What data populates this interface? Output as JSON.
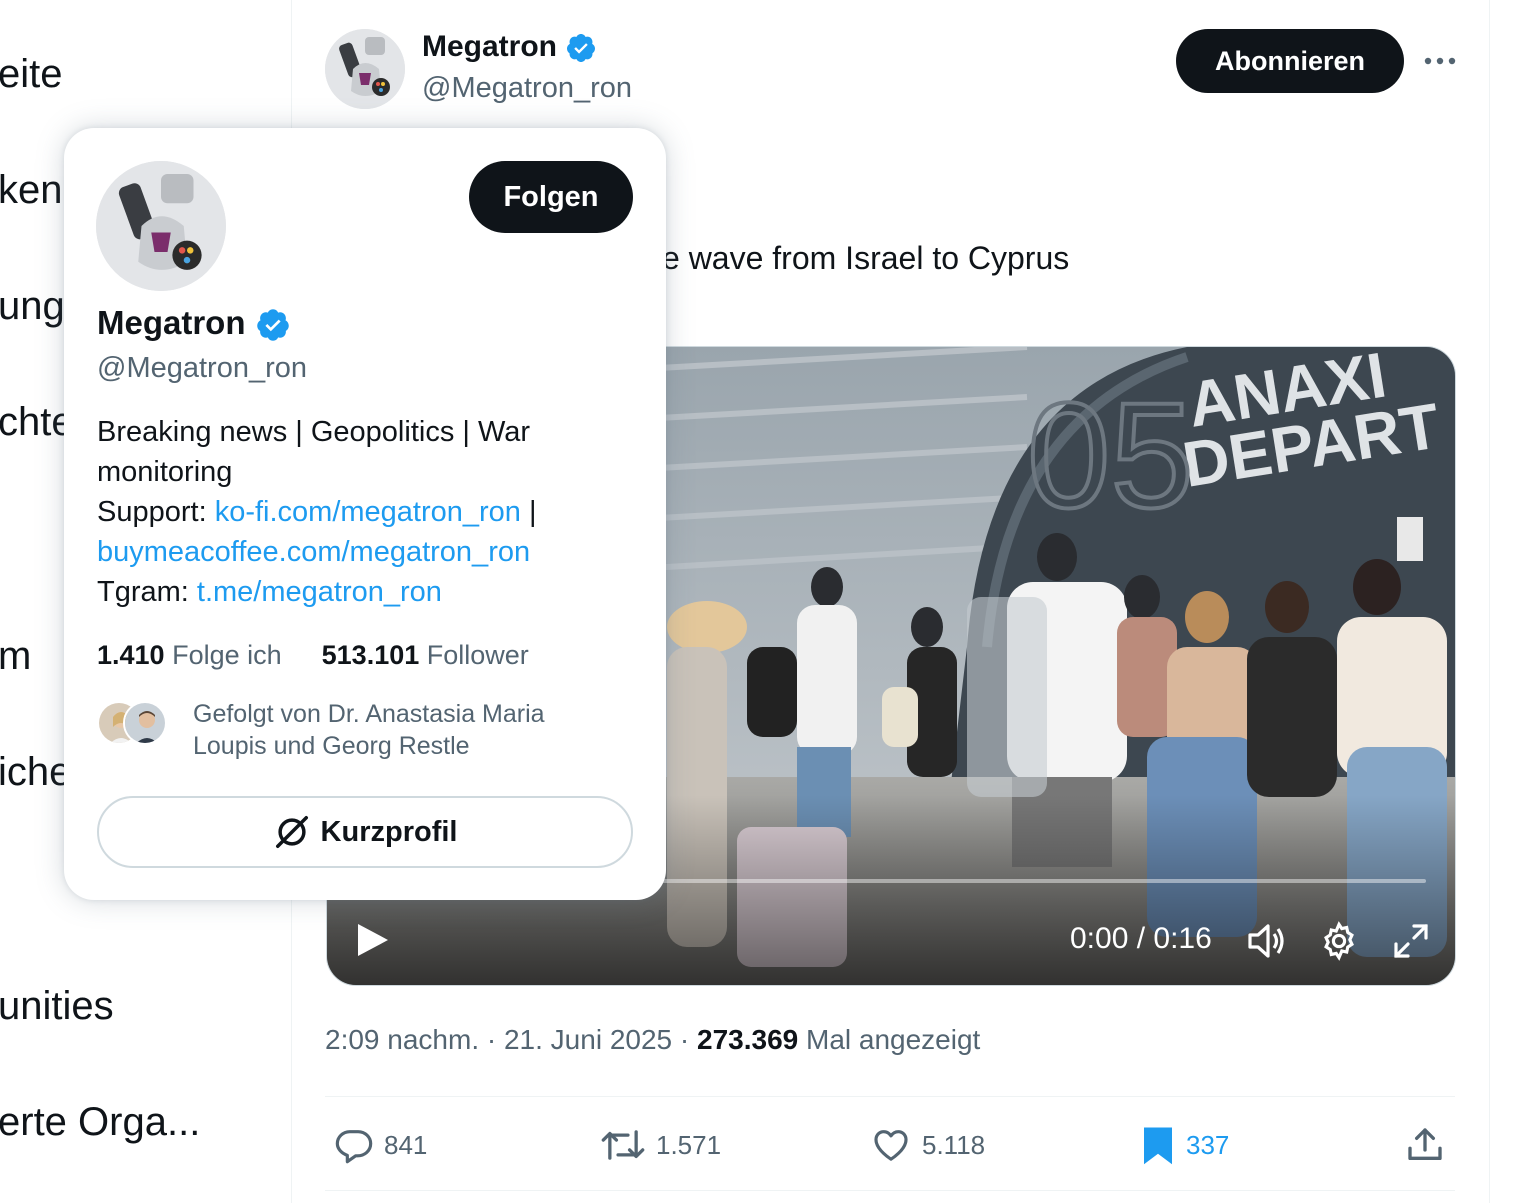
{
  "sidebar": {
    "items": [
      {
        "label": "eite"
      },
      {
        "label": "ken"
      },
      {
        "label": "unge"
      },
      {
        "label": "chte"
      },
      {
        "label": "m"
      },
      {
        "label": "iche"
      },
      {
        "label": "unities"
      },
      {
        "label": "erte Orga..."
      }
    ]
  },
  "tweet": {
    "author_name": "Megatron",
    "author_handle": "@Megatron_ron",
    "subscribe_label": "Abonnieren",
    "text_visible": "e wave from Israel to Cyprus",
    "timestamp": "2:09 nachm. · 21. Juni 2025 · ",
    "views": "273.369",
    "views_label": " Mal angezeigt",
    "video": {
      "time": "0:00 / 0:16",
      "progress": 0
    },
    "actions": {
      "replies": "841",
      "reposts": "1.571",
      "likes": "5.118",
      "bookmarks": "337"
    }
  },
  "hovercard": {
    "follow_label": "Folgen",
    "name": "Megatron",
    "handle": "@Megatron_ron",
    "bio_line1": "Breaking news | Geopolitics | War monitoring",
    "support_label": "Support: ",
    "support_link1": "ko-fi.com/megatron_ron",
    "support_sep": " |",
    "support_link2": "buymeacoffee.com/megatron_ron",
    "tgram_label": "Tgram: ",
    "tgram_link": "t.me/megatron_ron",
    "following_count": "1.410",
    "following_label": " Folge ich",
    "followers_count": "513.101",
    "followers_label": " Follower",
    "followed_by": "Gefolgt von Dr. Anastasia Maria Loupis und Georg Restle",
    "kurzprofil_label": "Kurzprofil"
  },
  "colors": {
    "accent": "#1d9bf0",
    "text": "#0f1419",
    "muted": "#536471"
  }
}
